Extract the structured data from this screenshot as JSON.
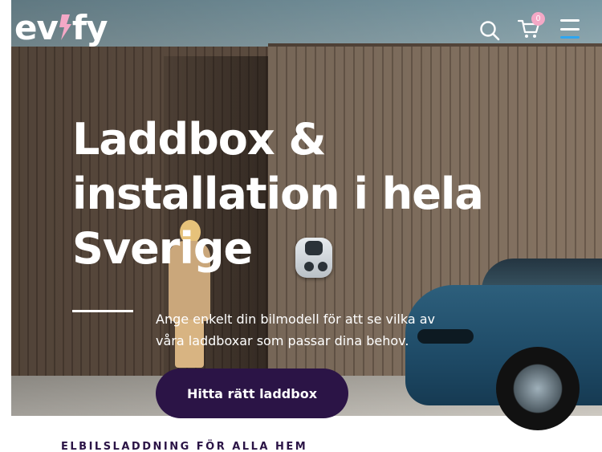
{
  "header": {
    "logo_prefix": "ev",
    "logo_bolt": "i",
    "logo_suffix": "fy",
    "cart_count": "0",
    "icons": [
      "search-icon",
      "cart-icon",
      "menu-icon"
    ]
  },
  "hero": {
    "title": "Laddbox & installation i hela Sverige",
    "subtitle": "Ange enkelt din bilmodell för att se vilka av våra laddboxar som passar dina behov.",
    "cta_label": "Hitta rätt laddbox"
  },
  "section": {
    "eyebrow": "ELBILSLADDNING FÖR ALLA HEM"
  },
  "colors": {
    "brand_dark": "#2b1446",
    "badge_pink": "#f4a8c6",
    "menu_accent": "#2ea6f0",
    "bolt_pink": "#f4a8c6"
  }
}
